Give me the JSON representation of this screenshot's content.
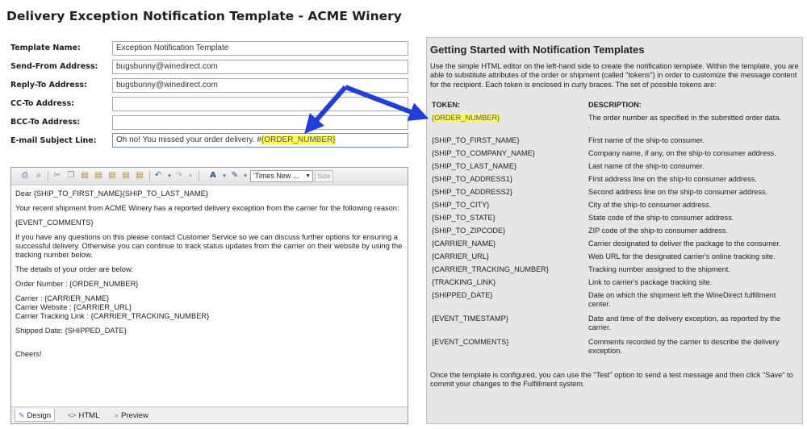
{
  "page_title": "Delivery Exception Notification Template - ACME Winery",
  "form": {
    "template_name": {
      "label": "Template Name:",
      "value": "Exception Notification Template"
    },
    "send_from": {
      "label": "Send-From Address:",
      "value": "bugsbunny@winedirect.com"
    },
    "reply_to": {
      "label": "Reply-To Address:",
      "value": "bugsbunny@winedirect.com"
    },
    "cc_to": {
      "label": "CC-To Address:",
      "value": ""
    },
    "bcc_to": {
      "label": "BCC-To Address:",
      "value": ""
    },
    "subject": {
      "label": "E-mail Subject Line:",
      "prefix": "Oh no! You missed your order delivery. #",
      "token": "{ORDER_NUMBER}"
    }
  },
  "toolbar": {
    "icons": [
      "print-icon",
      "find-icon",
      "cut-icon",
      "copy-icon",
      "paste-icon",
      "paste-text-icon",
      "paste-word-icon",
      "paste-html-icon",
      "undo-icon",
      "redo-icon",
      "font-color-icon",
      "highlight-color-icon"
    ],
    "font_name": "'Times New ...",
    "font_size": "Size"
  },
  "editor": {
    "lines": [
      "Dear {SHIP_TO_FIRST_NAME}{SHIP_TO_LAST_NAME}",
      "Your recent shipment from ACME Winery has a reported delivery exception from the carrier for the following reason:",
      "{EVENT_COMMENTS}",
      "If you have any questions on this please contact Customer Service so we can discuss further options for ensuring a successful delivery.   Otherwise you can continue to track status updates from the carrier on their website by using the tracking number below.",
      "The details of your order are below:",
      "Order Number :   {ORDER_NUMBER}",
      "Carrier :  {CARRIER_NAME}",
      "Carrier Website :  {CARRIER_URL}",
      "Carrier Tracking Link :  {CARRIER_TRACKING_NUMBER}",
      "Shipped Date: {SHIPPED_DATE}",
      "Cheers!"
    ],
    "tabs": [
      "Design",
      "HTML",
      "Preview"
    ]
  },
  "help": {
    "title": "Getting Started with Notification Templates",
    "intro": "Use the simple HTML editor on the left-hand side to create the notification template. Within the template, you are able to substitute attributes of the order or shipment (called \"tokens\") in order to customize the message content for the recipient. Each token is enclosed in curly braces. The set of possible tokens are:",
    "col_token": "TOKEN:",
    "col_desc": "DESCRIPTION:",
    "tokens": [
      {
        "token": "{ORDER_NUMBER}",
        "desc": "The order number as specified in the submitted order data."
      },
      {
        "token": "{SHIP_TO_FIRST_NAME}",
        "desc": "First name of the ship-to consumer."
      },
      {
        "token": "{SHIP_TO_COMPANY_NAME}",
        "desc": "Company name, if any, on the ship-to consumer address."
      },
      {
        "token": "{SHIP_TO_LAST_NAME}",
        "desc": "Last name of the ship-to consumer."
      },
      {
        "token": "{SHIP_TO_ADDRESS1}",
        "desc": "First address line on the ship-to consumer address."
      },
      {
        "token": "{SHIP_TO_ADDRESS2}",
        "desc": "Second address line on the ship-to consumer address."
      },
      {
        "token": "{SHIP_TO_CITY}",
        "desc": "City of the ship-to consumer address."
      },
      {
        "token": "{SHIP_TO_STATE}",
        "desc": "State code of the ship-to consumer address."
      },
      {
        "token": "{SHIP_TO_ZIPCODE}",
        "desc": "ZIP code of the ship-to consumer address."
      },
      {
        "token": "{CARRIER_NAME}",
        "desc": "Carrier designated to deliver the package to the consumer."
      },
      {
        "token": "{CARRIER_URL}",
        "desc": "Web URL for the designated carrier's online tracking site."
      },
      {
        "token": "{CARRIER_TRACKING_NUMBER}",
        "desc": "Tracking number assigned to the shipment."
      },
      {
        "token": "{TRACKING_LINK}",
        "desc": "Link to carrier's package tracking site."
      },
      {
        "token": "{SHIPPED_DATE}",
        "desc": "Date on which the shipment left the WineDirect fulfillment center."
      },
      {
        "token": "{EVENT_TIMESTAMP}",
        "desc": "Date and time of the delivery exception, as reported by the carrier."
      },
      {
        "token": "{EVENT_COMMENTS}",
        "desc": "Comments recorded by the carrier to describe the delivery exception."
      }
    ],
    "footer": "Once the template is configured, you can use the \"Test\" option to send a test message and then click \"Save\" to commit your changes to the Fulfillment system."
  },
  "colors": {
    "highlight": "#fffb57",
    "arrow": "#1f3fd6"
  }
}
